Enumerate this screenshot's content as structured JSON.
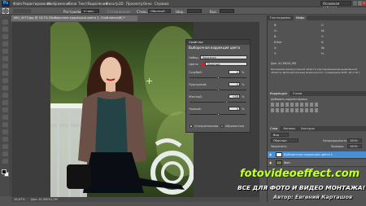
{
  "app": {
    "logo": "Ps"
  },
  "menu": [
    "Файл",
    "Редактирование",
    "Изображение",
    "Слои",
    "Текст",
    "Выделение",
    "Фильтр",
    "3D",
    "Просмотр",
    "Окно",
    "Справка"
  ],
  "preset": "Основная рабочая",
  "options": {
    "feather_label": "Растушевка:",
    "feather_value": "0 пикс.",
    "smooth_label": "Сглаживание",
    "style_label": "Стиль:",
    "style_value": "Обычный",
    "width_label": "Шир.:",
    "height_label": "Выс.:"
  },
  "document": {
    "tab": "IMG_4573.jpg @ 16,7% (Выборочная коррекция цвета 1, Слой-маска/8) *",
    "zoom": "16,67%",
    "doc_info": "Док: 41,9M/41,9M"
  },
  "properties": {
    "header": "Свойства",
    "title": "Выборочная коррекция цвета",
    "preset_label": "Набор:",
    "preset_value": "Заказная",
    "colors_label": "Цвета:",
    "colors_value": "Красные",
    "sliders": [
      {
        "label": "Голубой:",
        "value": "0",
        "unit": "%"
      },
      {
        "label": "Пурпурный:",
        "value": "0",
        "unit": "%"
      },
      {
        "label": "Желтый:",
        "value": "+28",
        "unit": "%"
      },
      {
        "label": "Черный:",
        "value": "0",
        "unit": "%"
      }
    ],
    "relative_label": "Относительная",
    "absolute_label": "Абсолютная"
  },
  "right_panel": {
    "top_tabs": [
      "Гистограмма",
      "Инфо"
    ],
    "info_lines": [
      "R:",
      "G:",
      "B:",
      "8-бит",
      "X:",
      "Y:"
    ],
    "info_values": [
      "C:",
      "M:",
      "Y:",
      "K:",
      "W:",
      "H:"
    ],
    "doc_line": "Док: 41,9M/41,9M",
    "hint": "Рисование прямоугольной области или перемещение выделенной области. Дополнительные возможности с клавишами Shift, Alt и Ctrl.",
    "adj_tabs": [
      "Коррекция",
      "Стили"
    ],
    "adj_title": "Добавить корректировку",
    "layers_tabs": [
      "Слои",
      "Каналы",
      "Контуры"
    ],
    "kind_label": "Вид",
    "blend_mode": "Обычные",
    "opacity_label": "Непрозрачность:",
    "opacity_value": "100%",
    "lock_label": "Закрепить:",
    "fill_label": "Заливка:",
    "fill_value": "100%",
    "layers": [
      {
        "name": "Выборочная коррекция цвета 1",
        "active": true
      },
      {
        "name": "Фон",
        "active": false
      }
    ]
  },
  "watermark": {
    "site": "fotovideoeffect.com",
    "tagline": "ВСЕ ДЛЯ ФОТО И ВИДЕО МОНТАЖА!",
    "author": "Автор: Евгений Карташов"
  },
  "colors": {
    "site_green": "#c8ff2a",
    "accent_blue": "#4a8fd6"
  }
}
